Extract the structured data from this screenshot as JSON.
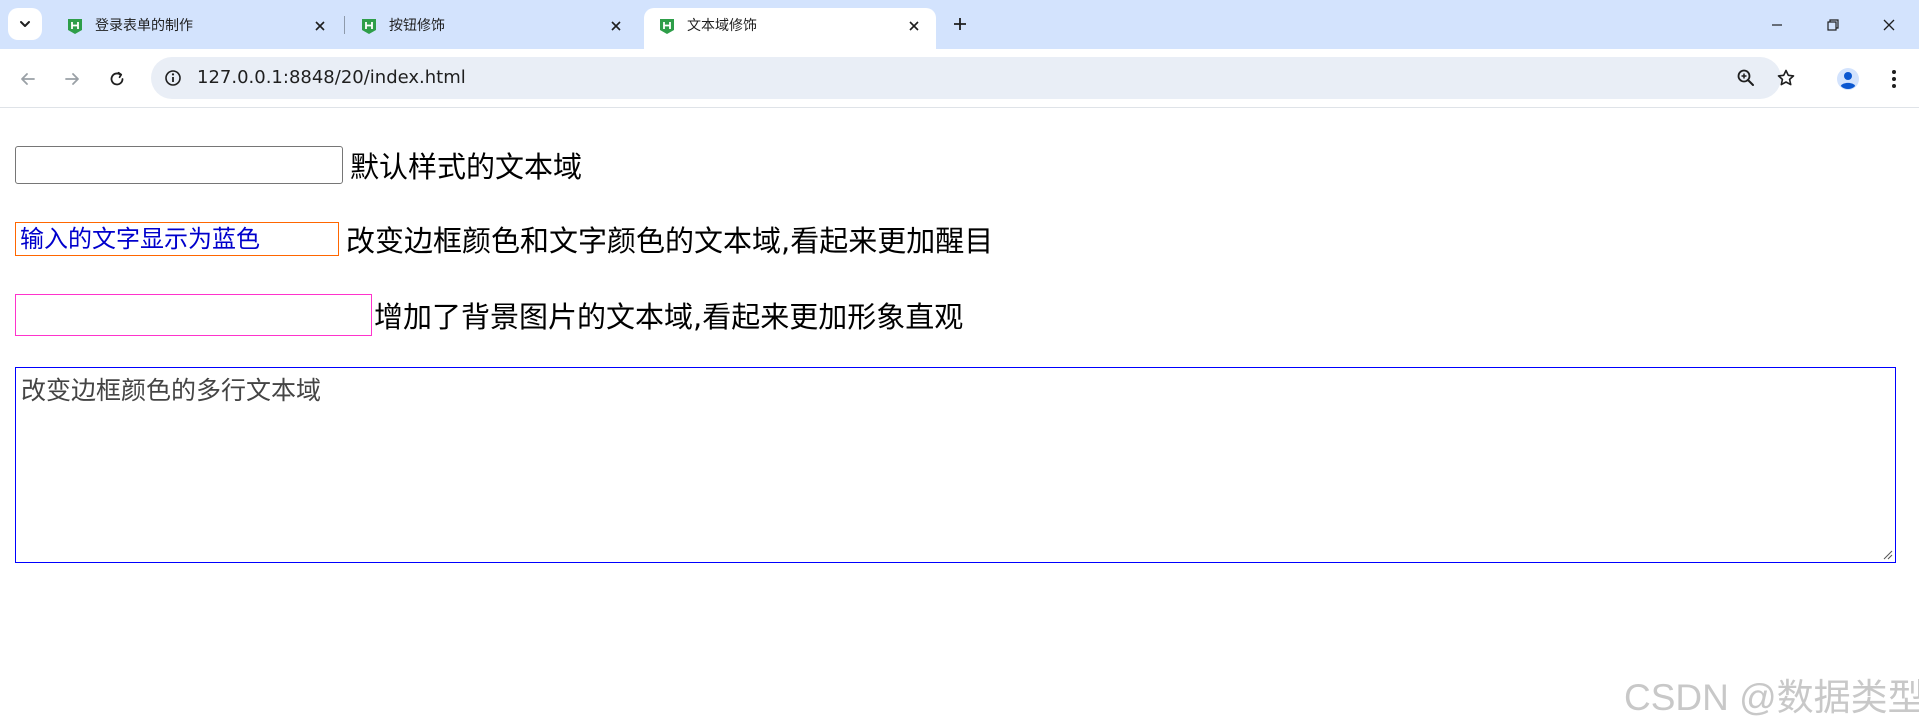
{
  "browser": {
    "tabs": [
      {
        "title": "登录表单的制作",
        "active": false
      },
      {
        "title": "按钮修饰",
        "active": false
      },
      {
        "title": "文本域修饰",
        "active": true
      }
    ],
    "url": "127.0.0.1:8848/20/index.html",
    "accent_color": "#d3e3fd",
    "favicon_color": "#2e9e49"
  },
  "page": {
    "row1_label": "默认样式的文本域",
    "row2_value": "输入的文字显示为蓝色",
    "row2_label": "改变边框颜色和文字颜色的文本域,看起来更加醒目",
    "row3_label": "增加了背景图片的文本域,看起来更加形象直观",
    "textarea_value": "改变边框颜色的多行文本域",
    "colors": {
      "row2_border": "#ff6600",
      "row2_text": "#0000cc",
      "row3_border": "#ff33cc",
      "textarea_border": "#0000ff"
    }
  },
  "watermark": "CSDN @数据类型"
}
